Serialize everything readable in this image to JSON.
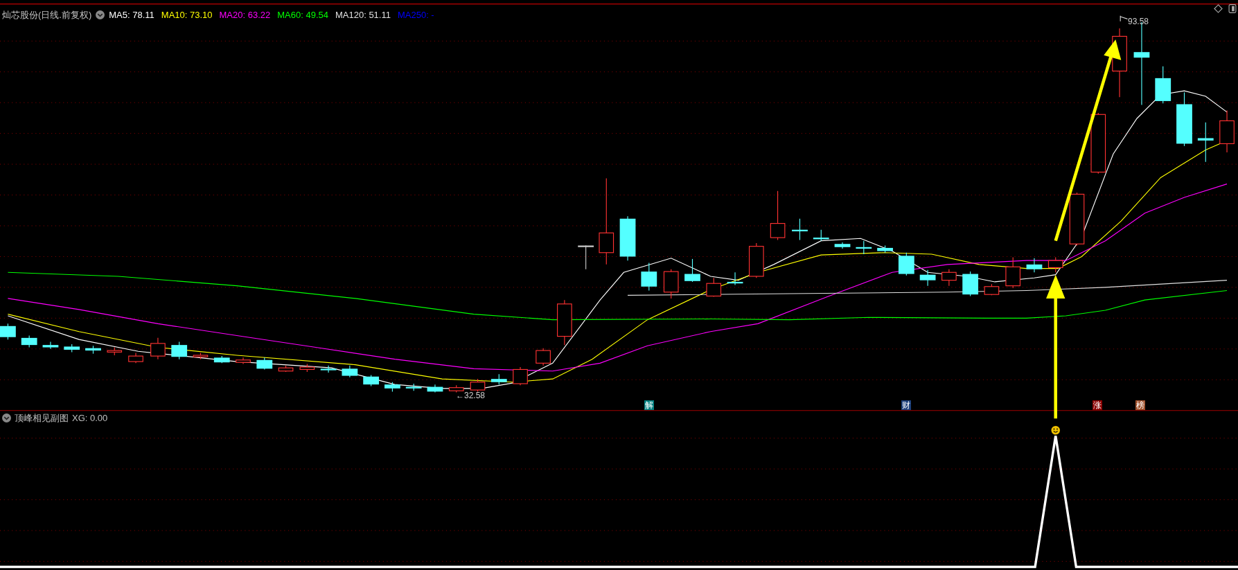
{
  "main_panel": {
    "title": "灿芯股份(日线.前复权)",
    "moving_averages": [
      {
        "label": "MA5: 78.11",
        "color": "#ffffff"
      },
      {
        "label": "MA10: 73.10",
        "color": "#ffff00"
      },
      {
        "label": "MA20: 63.22",
        "color": "#ff00ff"
      },
      {
        "label": "MA60: 49.54",
        "color": "#00ff00"
      },
      {
        "label": "MA120: 51.11",
        "color": "#e0e0e0"
      },
      {
        "label": "MA250: -",
        "color": "#0000ff"
      }
    ],
    "high_label": "93.58",
    "low_label": "←32.58",
    "event_markers": [
      {
        "text": "解",
        "color": "#008080"
      },
      {
        "text": "财",
        "color": "#1c3f7a"
      },
      {
        "text": "涨",
        "color": "#8b0000"
      },
      {
        "text": "榜",
        "color": "#a0522d"
      }
    ]
  },
  "indicator_panel": {
    "title": "顶峰相见副图",
    "reading": "XG: 0.00"
  }
}
